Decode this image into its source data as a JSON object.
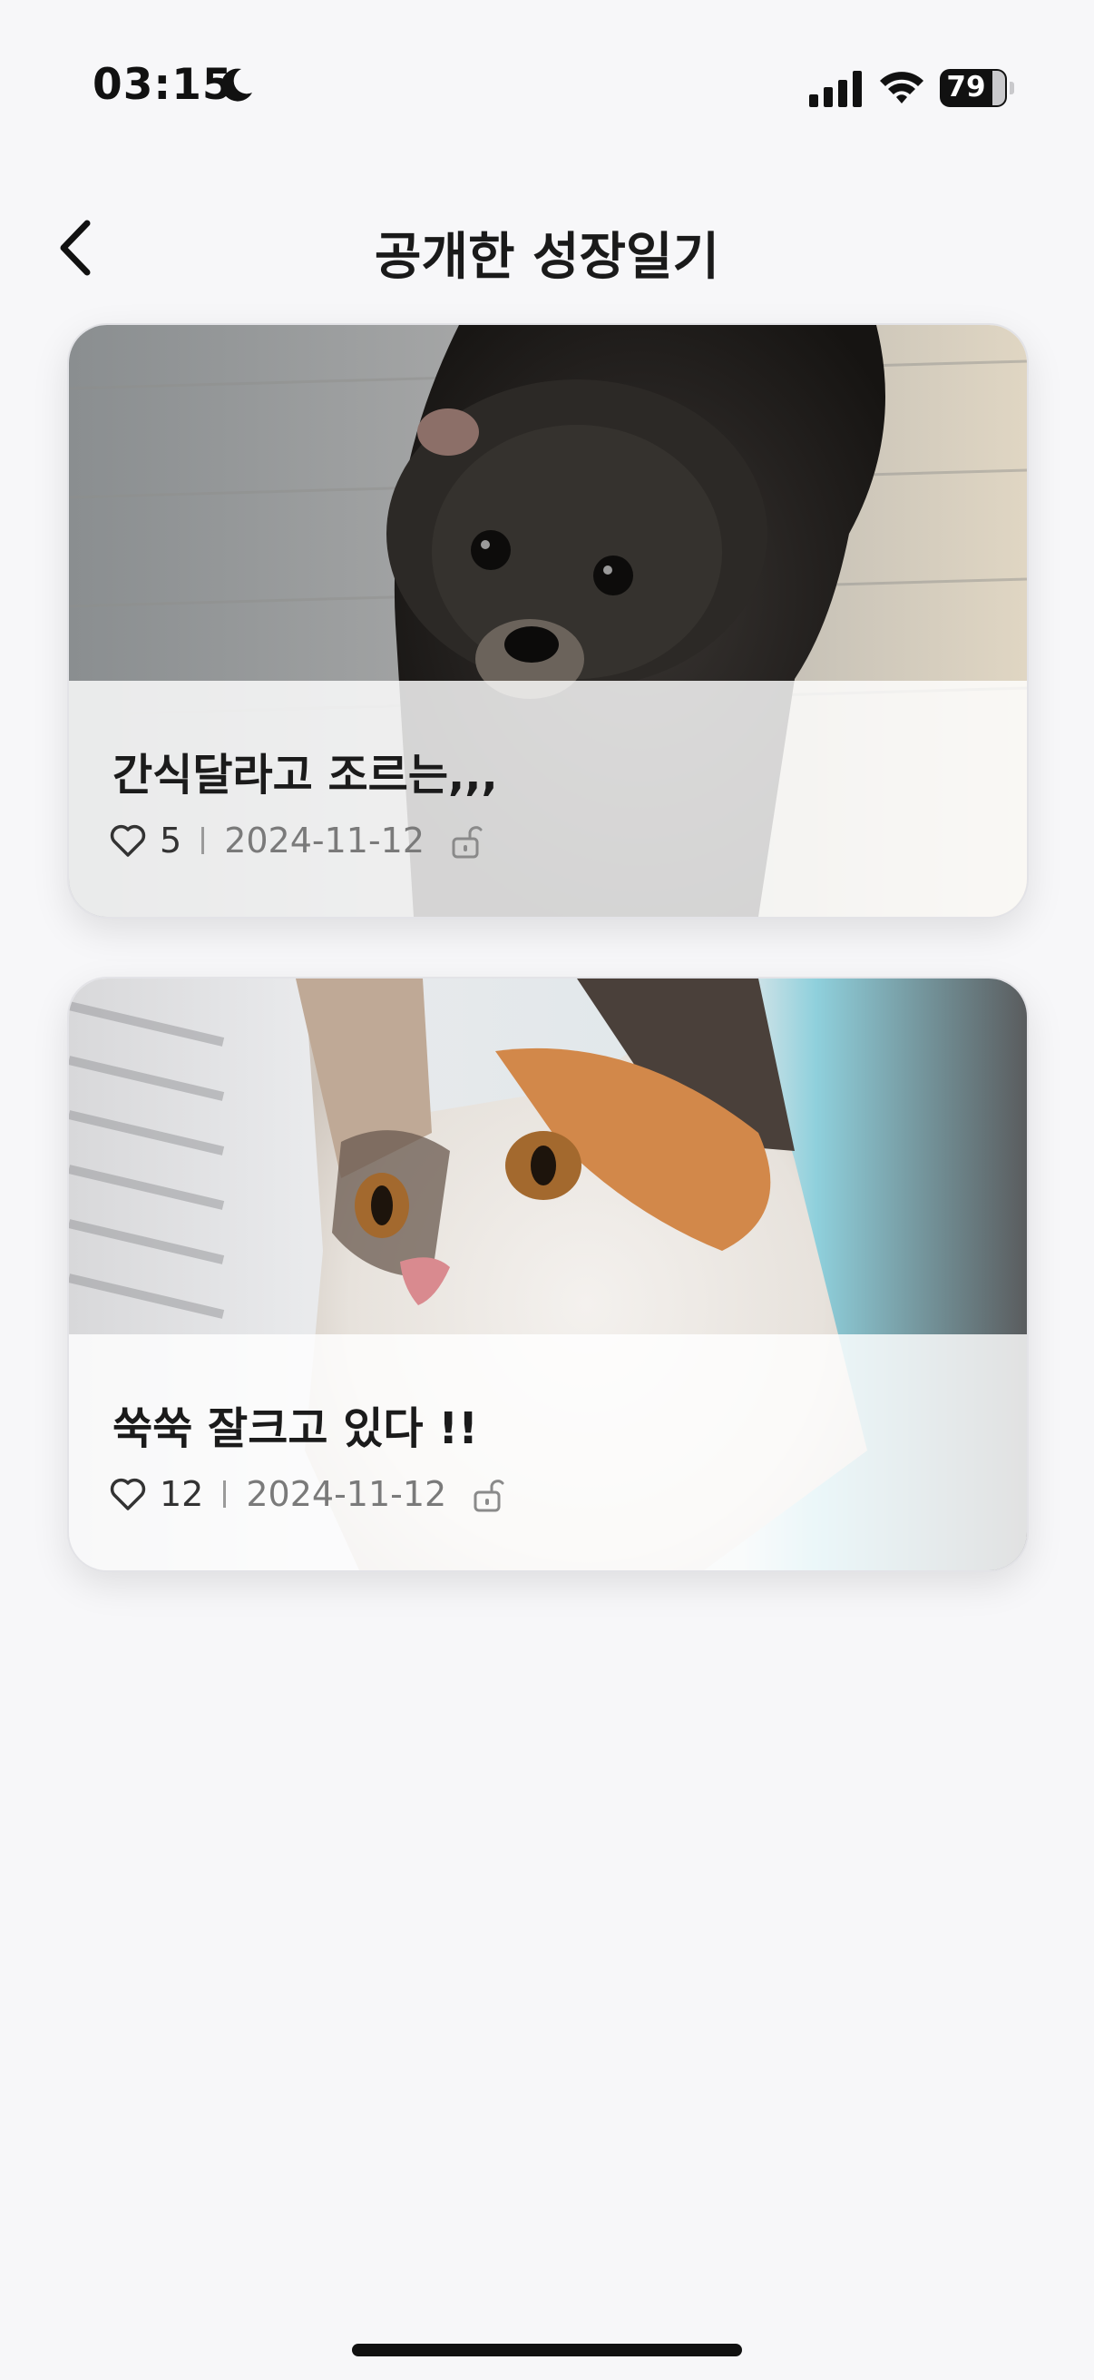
{
  "status": {
    "time": "03:15",
    "battery": "79"
  },
  "header": {
    "title": "공개한 성장일기"
  },
  "posts": [
    {
      "title": "간식달라고 조르는,,,",
      "likes": "5",
      "date": "2024-11-12"
    },
    {
      "title": "쑥쑥 잘크고 있다 !!",
      "likes": "12",
      "date": "2024-11-12"
    }
  ],
  "icons": {
    "back": "chevron-left-icon",
    "like": "heart-icon",
    "visibility": "unlock-icon",
    "moon": "moon-icon",
    "signal": "signal-icon",
    "wifi": "wifi-icon"
  },
  "colors": {
    "background": "#f7f7f9",
    "title_text": "#1b1b1b",
    "date_text": "#7a7a7a"
  }
}
